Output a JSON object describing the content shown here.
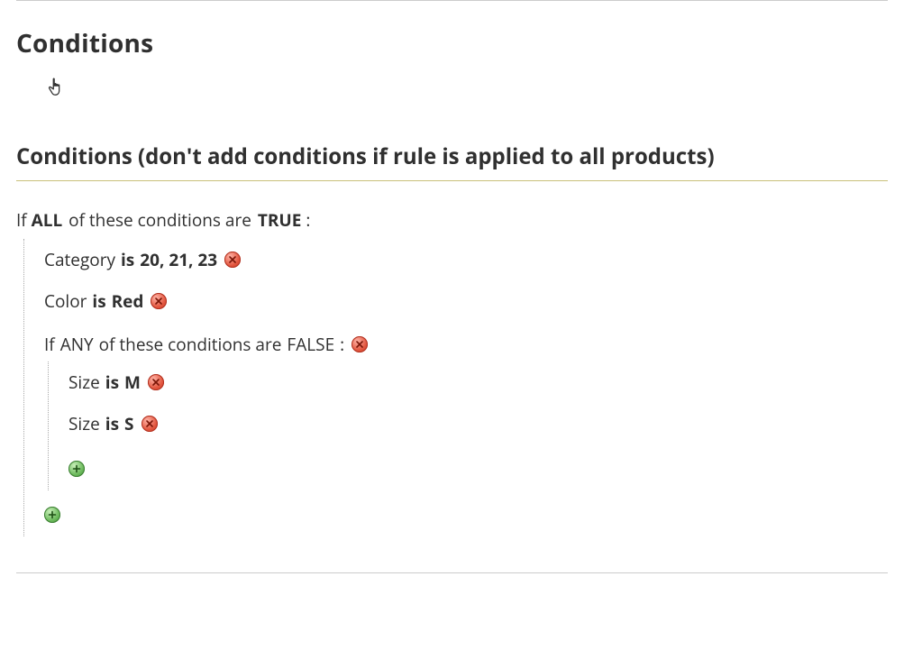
{
  "section_title": "Conditions",
  "fieldset_legend": "Conditions (don't add conditions if rule is applied to all products)",
  "root": {
    "prefix": "If",
    "aggregator": "ALL",
    "middle": "of these conditions are",
    "value": "TRUE",
    "suffix": ":"
  },
  "conditions": [
    {
      "attribute": "Category",
      "operator": "is",
      "value": "20, 21, 23"
    },
    {
      "attribute": "Color",
      "operator": "is",
      "value": "Red"
    }
  ],
  "nested": {
    "prefix": "If",
    "aggregator": "ANY",
    "middle": "of these conditions are",
    "value": "FALSE",
    "suffix": ":",
    "conditions": [
      {
        "attribute": "Size",
        "operator": "is",
        "value": "M"
      },
      {
        "attribute": "Size",
        "operator": "is",
        "value": "S"
      }
    ]
  }
}
